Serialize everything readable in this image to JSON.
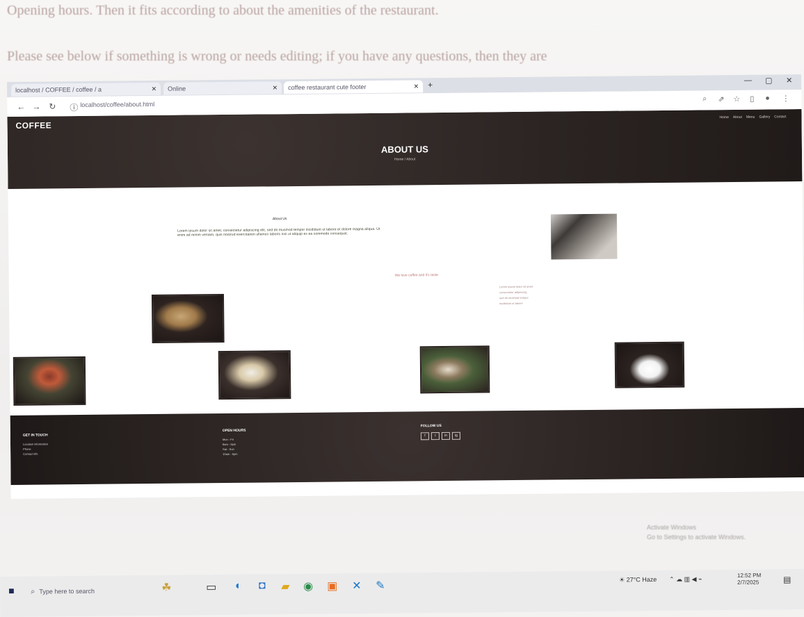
{
  "doc": {
    "line1": "Opening hours. Then it fits according to about the amenities of the restaurant.",
    "line2": "Please see below if something is wrong or needs editing; if you have any questions, then they are"
  },
  "browser": {
    "tabs": [
      {
        "label": "localhost / COFFEE / coffee / a"
      },
      {
        "label": "Online"
      },
      {
        "label": "coffee restaurant cute footer"
      }
    ],
    "url": "localhost/coffee/about.html"
  },
  "site": {
    "logo": "COFFEE",
    "nav": [
      "Home",
      "About",
      "Menu",
      "Gallery",
      "Contact"
    ],
    "hero_title": "ABOUT US",
    "hero_sub": "Home / About",
    "about_heading": "About Us",
    "about_text": "Lorem ipsum dolor sit amet, consectetur adipiscing elit, sed do eiusmod tempor incididunt ut labore et dolore magna aliqua. Ut enim ad minim veniam, quis nostrud exercitation ullamco laboris nisi ut aliquip ex ea commodo consequat.",
    "mid_link": "We love coffee and it's taste",
    "list": [
      "Lorem ipsum dolor sit amet",
      "consectetur adipiscing",
      "sed do eiusmod tempor",
      "incididunt ut labore"
    ],
    "footer": {
      "col1_heading": "GET IN TOUCH",
      "col1_items": [
        "Location information",
        "Phone",
        "Contact info"
      ],
      "col2_heading": "OPEN HOURS",
      "col2_items": [
        "Mon - Fri",
        "8am - 9pm",
        "Sat - Sun",
        "10am - 6pm"
      ],
      "col3_heading": "FOLLOW US",
      "social": [
        "f",
        "t",
        "in",
        "ig"
      ]
    }
  },
  "watermark": {
    "line1": "Activate Windows",
    "line2": "Go to Settings to activate Windows."
  },
  "taskbar": {
    "search_placeholder": "Type here to search",
    "weather": "27°C Haze",
    "time": "12:52 PM",
    "date": "2/7/2025"
  },
  "icons": [
    "windows-start-icon",
    "search-icon",
    "task-view-icon",
    "edge-icon",
    "file-explorer-icon",
    "store-icon",
    "chrome-icon",
    "xampp-icon",
    "vscode-icon",
    "app-icon"
  ]
}
